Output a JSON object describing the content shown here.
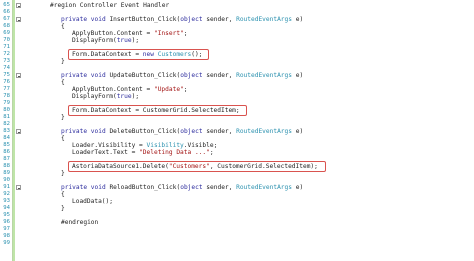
{
  "editor": {
    "lines": [
      {
        "num": "65",
        "indent": 0,
        "tokens": [
          {
            "t": "#region Controller Event Handler",
            "c": "plain"
          }
        ],
        "collapse": true
      },
      {
        "num": "66",
        "indent": 0,
        "tokens": []
      },
      {
        "num": "67",
        "indent": 1,
        "tokens": [
          {
            "t": "private void ",
            "c": "kw"
          },
          {
            "t": "InsertButton_Click(",
            "c": "plain"
          },
          {
            "t": "object",
            "c": "kw"
          },
          {
            "t": " sender, ",
            "c": "plain"
          },
          {
            "t": "RoutedEventArgs",
            "c": "ty"
          },
          {
            "t": " e)",
            "c": "plain"
          }
        ],
        "collapse": true
      },
      {
        "num": "68",
        "indent": 1,
        "tokens": [
          {
            "t": "{",
            "c": "plain"
          }
        ]
      },
      {
        "num": "69",
        "indent": 2,
        "tokens": [
          {
            "t": "ApplyButton.Content = ",
            "c": "plain"
          },
          {
            "t": "\"Insert\"",
            "c": "st"
          },
          {
            "t": ";",
            "c": "plain"
          }
        ]
      },
      {
        "num": "70",
        "indent": 2,
        "tokens": [
          {
            "t": "DisplayForm(",
            "c": "plain"
          },
          {
            "t": "true",
            "c": "kw"
          },
          {
            "t": ");",
            "c": "plain"
          }
        ]
      },
      {
        "num": "71",
        "indent": 0,
        "tokens": []
      },
      {
        "num": "72",
        "indent": 2,
        "tokens": [
          {
            "t": "Form.DataContext = ",
            "c": "plain"
          },
          {
            "t": "new ",
            "c": "kw"
          },
          {
            "t": "Customers",
            "c": "ty"
          },
          {
            "t": "();",
            "c": "plain"
          }
        ]
      },
      {
        "num": "73",
        "indent": 1,
        "tokens": [
          {
            "t": "}",
            "c": "plain"
          }
        ]
      },
      {
        "num": "74",
        "indent": 0,
        "tokens": []
      },
      {
        "num": "75",
        "indent": 1,
        "tokens": [
          {
            "t": "private void ",
            "c": "kw"
          },
          {
            "t": "UpdateButton_Click(",
            "c": "plain"
          },
          {
            "t": "object",
            "c": "kw"
          },
          {
            "t": " sender, ",
            "c": "plain"
          },
          {
            "t": "RoutedEventArgs",
            "c": "ty"
          },
          {
            "t": " e)",
            "c": "plain"
          }
        ],
        "collapse": true
      },
      {
        "num": "76",
        "indent": 1,
        "tokens": [
          {
            "t": "{",
            "c": "plain"
          }
        ]
      },
      {
        "num": "77",
        "indent": 2,
        "tokens": [
          {
            "t": "ApplyButton.Content = ",
            "c": "plain"
          },
          {
            "t": "\"Update\"",
            "c": "st"
          },
          {
            "t": ";",
            "c": "plain"
          }
        ]
      },
      {
        "num": "78",
        "indent": 2,
        "tokens": [
          {
            "t": "DisplayForm(",
            "c": "plain"
          },
          {
            "t": "true",
            "c": "kw"
          },
          {
            "t": ");",
            "c": "plain"
          }
        ]
      },
      {
        "num": "79",
        "indent": 0,
        "tokens": []
      },
      {
        "num": "80",
        "indent": 2,
        "tokens": [
          {
            "t": "Form.DataContext = CustomerGrid.SelectedItem;",
            "c": "plain"
          }
        ]
      },
      {
        "num": "81",
        "indent": 1,
        "tokens": [
          {
            "t": "}",
            "c": "plain"
          }
        ]
      },
      {
        "num": "82",
        "indent": 0,
        "tokens": []
      },
      {
        "num": "83",
        "indent": 1,
        "tokens": [
          {
            "t": "private void ",
            "c": "kw"
          },
          {
            "t": "DeleteButton_Click(",
            "c": "plain"
          },
          {
            "t": "object",
            "c": "kw"
          },
          {
            "t": " sender, ",
            "c": "plain"
          },
          {
            "t": "RoutedEventArgs",
            "c": "ty"
          },
          {
            "t": " e)",
            "c": "plain"
          }
        ],
        "collapse": true
      },
      {
        "num": "84",
        "indent": 1,
        "tokens": [
          {
            "t": "{",
            "c": "plain"
          }
        ]
      },
      {
        "num": "85",
        "indent": 2,
        "tokens": [
          {
            "t": "Loader.Visibility = ",
            "c": "plain"
          },
          {
            "t": "Visibility",
            "c": "ty"
          },
          {
            "t": ".Visible;",
            "c": "plain"
          }
        ]
      },
      {
        "num": "86",
        "indent": 2,
        "tokens": [
          {
            "t": "LoaderText.Text = ",
            "c": "plain"
          },
          {
            "t": "\"Deleting Data ...\"",
            "c": "st"
          },
          {
            "t": ";",
            "c": "plain"
          }
        ]
      },
      {
        "num": "87",
        "indent": 0,
        "tokens": []
      },
      {
        "num": "88",
        "indent": 2,
        "tokens": [
          {
            "t": "AstoriaDataSource1.Delete(",
            "c": "plain"
          },
          {
            "t": "\"Customers\"",
            "c": "st"
          },
          {
            "t": ", CustomerGrid.SelectedItem);",
            "c": "plain"
          }
        ]
      },
      {
        "num": "89",
        "indent": 1,
        "tokens": [
          {
            "t": "}",
            "c": "plain"
          }
        ]
      },
      {
        "num": "90",
        "indent": 0,
        "tokens": []
      },
      {
        "num": "91",
        "indent": 1,
        "tokens": [
          {
            "t": "private void ",
            "c": "kw"
          },
          {
            "t": "ReloadButton_Click(",
            "c": "plain"
          },
          {
            "t": "object",
            "c": "kw"
          },
          {
            "t": " sender, ",
            "c": "plain"
          },
          {
            "t": "RoutedEventArgs",
            "c": "ty"
          },
          {
            "t": " e)",
            "c": "plain"
          }
        ],
        "collapse": true
      },
      {
        "num": "92",
        "indent": 1,
        "tokens": [
          {
            "t": "{",
            "c": "plain"
          }
        ]
      },
      {
        "num": "93",
        "indent": 2,
        "tokens": [
          {
            "t": "LoadData();",
            "c": "plain"
          }
        ]
      },
      {
        "num": "94",
        "indent": 1,
        "tokens": [
          {
            "t": "}",
            "c": "plain"
          }
        ]
      },
      {
        "num": "95",
        "indent": 0,
        "tokens": []
      },
      {
        "num": "96",
        "indent": 1,
        "tokens": [
          {
            "t": "#endregion",
            "c": "plain"
          }
        ]
      },
      {
        "num": "97",
        "indent": 0,
        "tokens": []
      },
      {
        "num": "98",
        "indent": 0,
        "tokens": []
      },
      {
        "num": "99",
        "indent": 0,
        "tokens": []
      }
    ],
    "highlighted_lines": [
      "72",
      "80",
      "88"
    ],
    "colors": {
      "keyword": "#2d2d9e",
      "type": "#2b91af",
      "string": "#a31515",
      "line_number": "#2b91af",
      "highlight_box": "#d9534f",
      "change_bar": "#bfe5a8"
    }
  }
}
